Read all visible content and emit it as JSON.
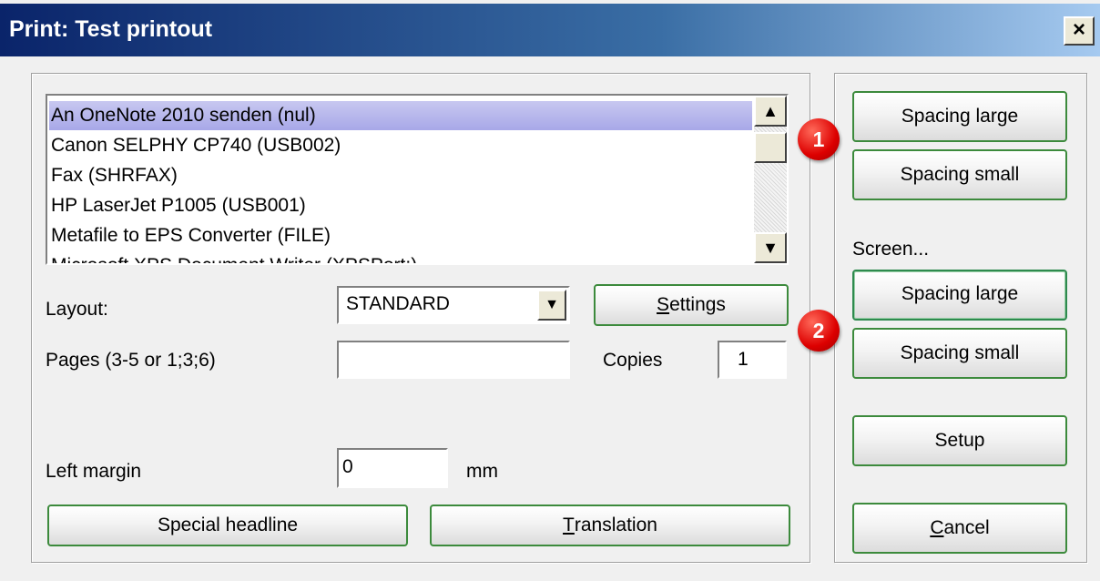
{
  "window": {
    "title": "Print: Test printout",
    "close_label": "×"
  },
  "printers": [
    "An OneNote 2010 senden (nul)",
    "Canon SELPHY CP740 (USB002)",
    "Fax (SHRFAX)",
    "HP LaserJet P1005 (USB001)",
    "Metafile to EPS Converter (FILE)",
    "Microsoft XPS Document Writer (XPSPort:)"
  ],
  "selected_printer_index": 0,
  "layout": {
    "label": "Layout:",
    "value": "STANDARD"
  },
  "settings_button": {
    "mnemonic": "S",
    "rest": "ettings"
  },
  "pages": {
    "label": "Pages (3-5 or 1;3;6)",
    "value": ""
  },
  "copies": {
    "label": "Copies",
    "value": "1"
  },
  "left_margin": {
    "label": "Left margin",
    "value": "0",
    "unit": "mm"
  },
  "special_headline_button": "Special headline",
  "translation_button": {
    "mnemonic": "T",
    "rest": "ranslation"
  },
  "right_panel": {
    "spacing_large_1": "Spacing large",
    "spacing_small_1": "Spacing small",
    "screen_label": "Screen...",
    "spacing_large_2": "Spacing large",
    "spacing_small_2": "Spacing small",
    "setup": "Setup",
    "cancel": {
      "mnemonic": "C",
      "rest": "ancel"
    }
  },
  "badges": {
    "badge_1": "1",
    "badge_2": "2"
  },
  "colors": {
    "title_start": "#0a246a",
    "title_end": "#a6caf0",
    "button_border": "#3c8a3c",
    "badge": "#dd0000",
    "selection": "#b8b8ee"
  }
}
